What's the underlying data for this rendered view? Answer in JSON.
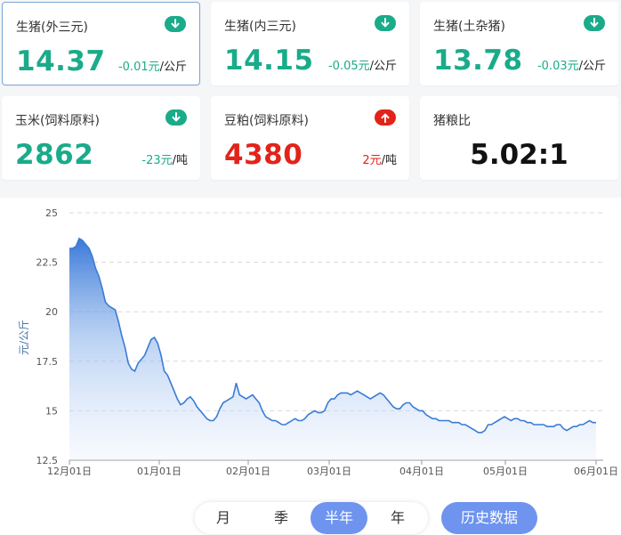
{
  "cards": [
    {
      "name": "生猪(外三元)",
      "price": "14.37",
      "change": "-0.01元",
      "unit": "/公斤",
      "trend": "down",
      "selected": true
    },
    {
      "name": "生猪(内三元)",
      "price": "14.15",
      "change": "-0.05元",
      "unit": "/公斤",
      "trend": "down"
    },
    {
      "name": "生猪(土杂猪)",
      "price": "13.78",
      "change": "-0.03元",
      "unit": "/公斤",
      "trend": "down"
    },
    {
      "name": "玉米(饲料原料)",
      "price": "2862",
      "change": "-23元",
      "unit": "/吨",
      "trend": "down"
    },
    {
      "name": "豆粕(饲料原料)",
      "price": "4380",
      "change": "2元",
      "unit": "/吨",
      "trend": "up"
    },
    {
      "name": "猪粮比",
      "value": "5.02:1"
    }
  ],
  "colors": {
    "down": "#1aab8a",
    "up": "#e2231a",
    "line": "#3a7bd5",
    "accent": "#6e94f0"
  },
  "icons": {
    "down": "arrow-down-circle-icon",
    "up": "arrow-up-circle-icon"
  },
  "chart_data": {
    "type": "area",
    "ylabel": "元/公斤",
    "ylim": [
      12.5,
      25
    ],
    "yticks": [
      "12.5",
      "15",
      "17.5",
      "20",
      "22.5",
      "25"
    ],
    "xticks": [
      "12月01日",
      "01月01日",
      "02月01日",
      "03月01日",
      "04月01日",
      "05月01日",
      "06月01日"
    ],
    "grid": true,
    "series": [
      {
        "x_start": "12月01日",
        "x_end": "06月01日",
        "values": [
          23.2,
          23.2,
          23.3,
          23.7,
          23.6,
          23.4,
          23.2,
          22.8,
          22.2,
          21.8,
          21.2,
          20.5,
          20.3,
          20.2,
          20.1,
          19.5,
          18.8,
          18.2,
          17.4,
          17.1,
          17.0,
          17.4,
          17.6,
          17.8,
          18.2,
          18.6,
          18.7,
          18.4,
          17.8,
          17.0,
          16.8,
          16.4,
          16.0,
          15.6,
          15.3,
          15.4,
          15.6,
          15.7,
          15.5,
          15.2,
          15.0,
          14.8,
          14.6,
          14.5,
          14.5,
          14.7,
          15.1,
          15.4,
          15.5,
          15.6,
          15.7,
          16.4,
          15.8,
          15.7,
          15.6,
          15.7,
          15.8,
          15.6,
          15.4,
          15.0,
          14.7,
          14.6,
          14.5,
          14.5,
          14.4,
          14.3,
          14.3,
          14.4,
          14.5,
          14.6,
          14.5,
          14.5,
          14.6,
          14.8,
          14.9,
          15.0,
          14.9,
          14.9,
          15.0,
          15.4,
          15.6,
          15.6,
          15.8,
          15.9,
          15.9,
          15.9,
          15.8,
          15.9,
          16.0,
          15.9,
          15.8,
          15.7,
          15.6,
          15.7,
          15.8,
          15.9,
          15.8,
          15.6,
          15.4,
          15.2,
          15.1,
          15.1,
          15.3,
          15.4,
          15.4,
          15.2,
          15.1,
          15.0,
          15.0,
          14.8,
          14.7,
          14.6,
          14.6,
          14.5,
          14.5,
          14.5,
          14.5,
          14.4,
          14.4,
          14.4,
          14.3,
          14.3,
          14.2,
          14.1,
          14.0,
          13.9,
          13.9,
          14.0,
          14.3,
          14.3,
          14.4,
          14.5,
          14.6,
          14.7,
          14.6,
          14.5,
          14.6,
          14.6,
          14.5,
          14.5,
          14.4,
          14.4,
          14.3,
          14.3,
          14.3,
          14.3,
          14.2,
          14.2,
          14.2,
          14.3,
          14.3,
          14.1,
          14.0,
          14.1,
          14.2,
          14.2,
          14.3,
          14.3,
          14.4,
          14.5,
          14.4,
          14.4
        ]
      }
    ]
  },
  "period": {
    "options": [
      "月",
      "季",
      "半年",
      "年"
    ],
    "active": "半年"
  },
  "history_button": "历史数据"
}
